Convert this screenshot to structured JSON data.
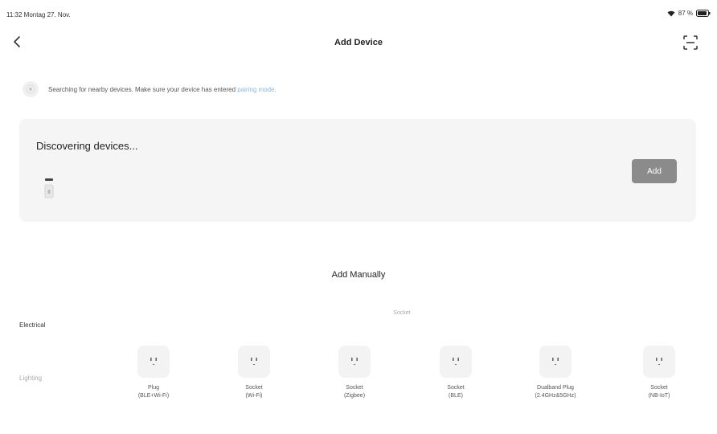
{
  "status_bar": {
    "time": "11:32",
    "date": "Montag 27. Nov.",
    "battery": "87 %"
  },
  "header": {
    "title": "Add Device",
    "back_icon": "chevron-left-icon",
    "scan_icon": "scan-icon"
  },
  "search_notice": {
    "text": "Searching for nearby devices. Make sure your device has entered ",
    "link": "pairing mode."
  },
  "discovery": {
    "title": "Discovering devices...",
    "add_label": "Add",
    "add_color": "#8b8b8b"
  },
  "manual": {
    "title": "Add Manually",
    "categories": [
      {
        "label": "Electrical",
        "selected": true
      },
      {
        "label": "Lighting",
        "selected": false
      }
    ],
    "subcategory": "Socket",
    "devices": [
      {
        "name": "Plug",
        "protocol": "(BLE+Wi-Fi)"
      },
      {
        "name": "Socket",
        "protocol": "(Wi-Fi)"
      },
      {
        "name": "Socket",
        "protocol": "(Zigbee)"
      },
      {
        "name": "Socket",
        "protocol": "(BLE)"
      },
      {
        "name": "Dualband Plug",
        "protocol": "(2.4GHz&5GHz)"
      },
      {
        "name": "Socket",
        "protocol": "(NB-IoT)"
      }
    ]
  }
}
